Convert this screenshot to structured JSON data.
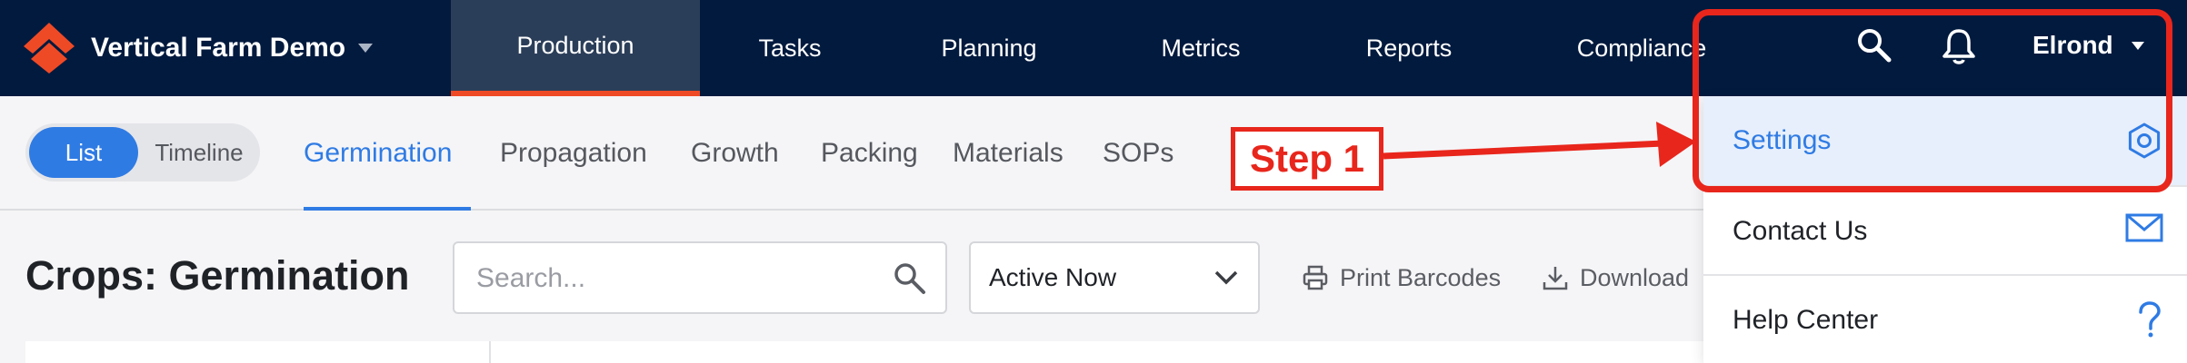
{
  "app": {
    "name": "Vertical Farm Demo",
    "brand_color": "#ef4a26"
  },
  "nav": {
    "items": [
      "Production",
      "Tasks",
      "Planning",
      "Metrics",
      "Reports",
      "Compliance"
    ],
    "active": "Production"
  },
  "header": {
    "search_icon": "search-icon",
    "notifications_icon": "bell-icon",
    "user_name": "Elrond"
  },
  "subnav": {
    "view_toggle": [
      "List",
      "Timeline"
    ],
    "active_view": "List",
    "tabs": [
      "Germination",
      "Propagation",
      "Growth",
      "Packing",
      "Materials",
      "SOPs"
    ],
    "active_tab": "Germination"
  },
  "page": {
    "title": "Crops: Germination",
    "search_placeholder": "Search...",
    "filter_value": "Active Now",
    "actions": [
      "Print Barcodes",
      "Download"
    ]
  },
  "user_menu": {
    "items": [
      {
        "label": "Settings",
        "icon": "gear-icon"
      },
      {
        "label": "Contact Us",
        "icon": "mail-icon"
      },
      {
        "label": "Help Center",
        "icon": "question-icon"
      }
    ]
  },
  "annotation": {
    "step_label": "Step 1",
    "color": "#e8261c"
  }
}
